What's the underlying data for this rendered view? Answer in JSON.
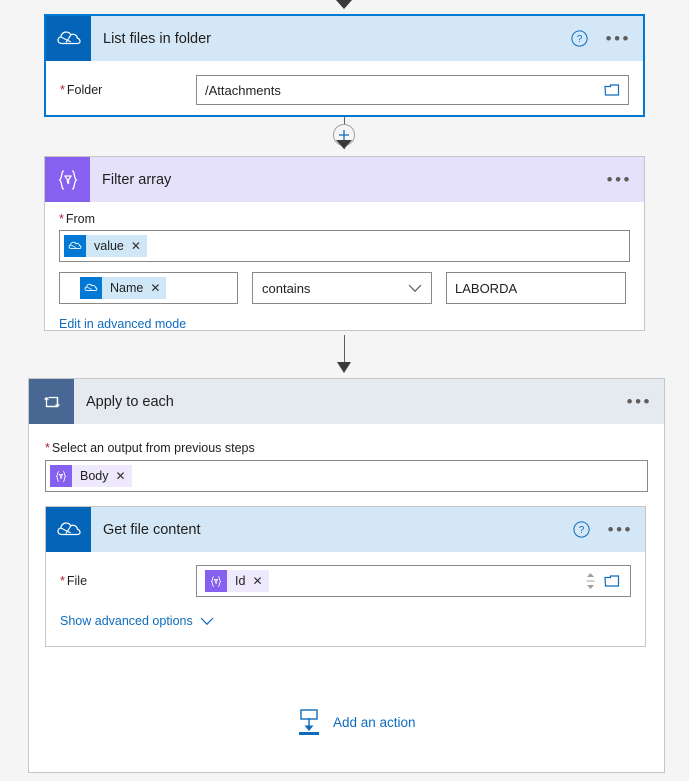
{
  "flow": {
    "steps": [
      {
        "id": "list-files-in-folder",
        "title": "List files in folder",
        "icon": "onedrive-cloud-icon",
        "help_icon": "help-circle-icon",
        "menu_icon": "ellipsis-icon",
        "fields": [
          {
            "label": "Folder",
            "required_marker": "*",
            "value": "/Attachments",
            "trailing_icon": "folder-picker-icon"
          }
        ]
      },
      {
        "id": "filter-array",
        "title": "Filter array",
        "icon": "filter-braces-icon",
        "menu_icon": "ellipsis-icon",
        "from_label": "From",
        "required_marker": "*",
        "from_token": {
          "label": "value",
          "icon": "onedrive-cloud-icon",
          "remove": "✕"
        },
        "condition": {
          "left_token": {
            "label": "Name",
            "icon": "onedrive-cloud-icon",
            "remove": "✕"
          },
          "operator": "contains",
          "operator_chevron": "chevron-down-icon",
          "right_value": "LABORDA"
        },
        "advanced_link": "Edit in advanced mode"
      },
      {
        "id": "apply-to-each",
        "title": "Apply to each",
        "icon": "loop-icon",
        "menu_icon": "ellipsis-icon",
        "select_label": "Select an output from previous steps",
        "required_marker": "*",
        "select_token": {
          "label": "Body",
          "icon": "filter-braces-icon",
          "remove": "✕"
        },
        "inner_step": {
          "id": "get-file-content",
          "title": "Get file content",
          "icon": "onedrive-cloud-icon",
          "help_icon": "help-circle-icon",
          "menu_icon": "ellipsis-icon",
          "field": {
            "label": "File",
            "required_marker": "*",
            "token": {
              "label": "Id",
              "icon": "filter-braces-icon",
              "remove": "✕"
            },
            "spinner_icon": "spinner-updown-icon",
            "trailing_icon": "folder-picker-icon"
          },
          "advanced_link": "Show advanced options",
          "advanced_chevron": "chevron-down-icon"
        },
        "add_action": {
          "label": "Add an action",
          "icon": "add-action-icon"
        }
      }
    ],
    "connectors": [
      {
        "id": "top-connector",
        "has_plus": false
      },
      {
        "id": "connector-list-to-filter",
        "has_plus": true,
        "plus_icon": "plus-icon"
      },
      {
        "id": "connector-filter-to-loop",
        "has_plus": false
      }
    ]
  },
  "colors": {
    "onedrive_blue": "#0364b8",
    "purple": "#8661f0",
    "loop_slate": "#486793",
    "link_blue": "#0f6cbd",
    "selected_border": "#0078d4",
    "required_red": "#a4262c",
    "canvas_bg": "#f5f5f5"
  }
}
